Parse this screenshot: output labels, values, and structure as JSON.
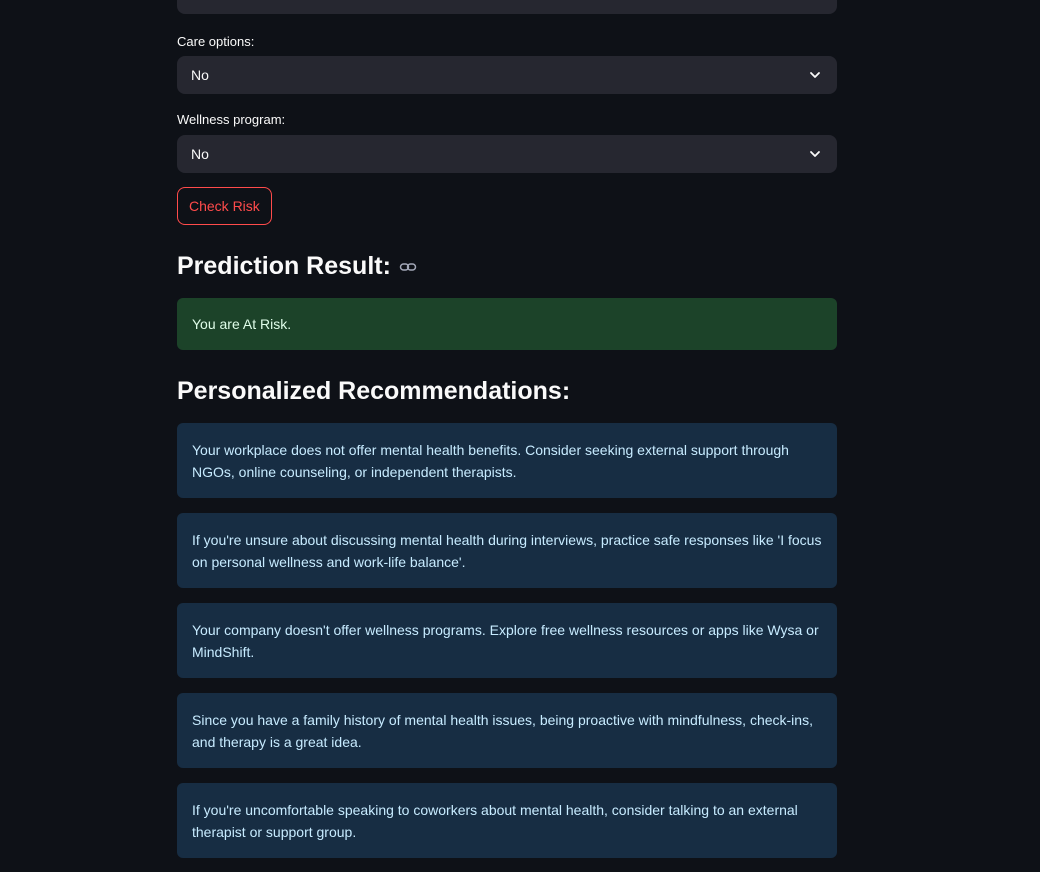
{
  "form": {
    "care_options": {
      "label": "Care options:",
      "value": "No"
    },
    "wellness_program": {
      "label": "Wellness program:",
      "value": "No"
    },
    "check_button": "Check Risk"
  },
  "prediction": {
    "heading": "Prediction Result:",
    "result": "You are At Risk."
  },
  "recommendations": {
    "heading": "Personalized Recommendations:",
    "items": [
      "Your workplace does not offer mental health benefits. Consider seeking external support through NGOs, online counseling, or independent therapists.",
      "If you're unsure about discussing mental health during interviews, practice safe responses like 'I focus on personal wellness and work-life balance'.",
      "Your company doesn't offer wellness programs. Explore free wellness resources or apps like Wysa or MindShift.",
      "Since you have a family history of mental health issues, being proactive with mindfulness, check-ins, and therapy is a great idea.",
      "If you're uncomfortable speaking to coworkers about mental health, consider talking to an external therapist or support group."
    ]
  },
  "colors": {
    "background": "#0e1117",
    "select_bg": "#262730",
    "accent": "#ff4b4b",
    "success_bg": "#1c4329",
    "info_bg": "#172d43"
  },
  "icons": {
    "select": "chevron-down-icon",
    "heading_anchor": "link-icon"
  }
}
